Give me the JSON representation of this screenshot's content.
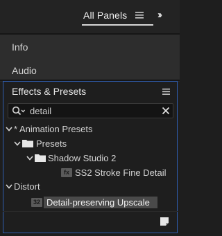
{
  "header": {
    "workspace_label": "All Panels",
    "menu_icon": "hamburger-icon",
    "overflow_icon": "chevrons-right-icon"
  },
  "panels": {
    "info_label": "Info",
    "audio_label": "Audio"
  },
  "effects_panel": {
    "title": "Effects & Presets",
    "menu_icon": "hamburger-icon",
    "search": {
      "value": "detail",
      "search_icon": "search-icon",
      "clear_icon": "close-icon"
    },
    "tree": {
      "animation_presets": "* Animation Presets",
      "presets": "Presets",
      "shadow_studio": "Shadow Studio 2",
      "ss2_stroke": "SS2 Stroke Fine Detail",
      "distort": "Distort",
      "detail_upscale": "Detail-preserving Upscale",
      "preset_badge": "fx",
      "effect_badge": "32"
    },
    "footer_icon": "new-item-icon"
  },
  "colors": {
    "focus_border": "#2f5db0",
    "selection": "#4a4a4a"
  }
}
